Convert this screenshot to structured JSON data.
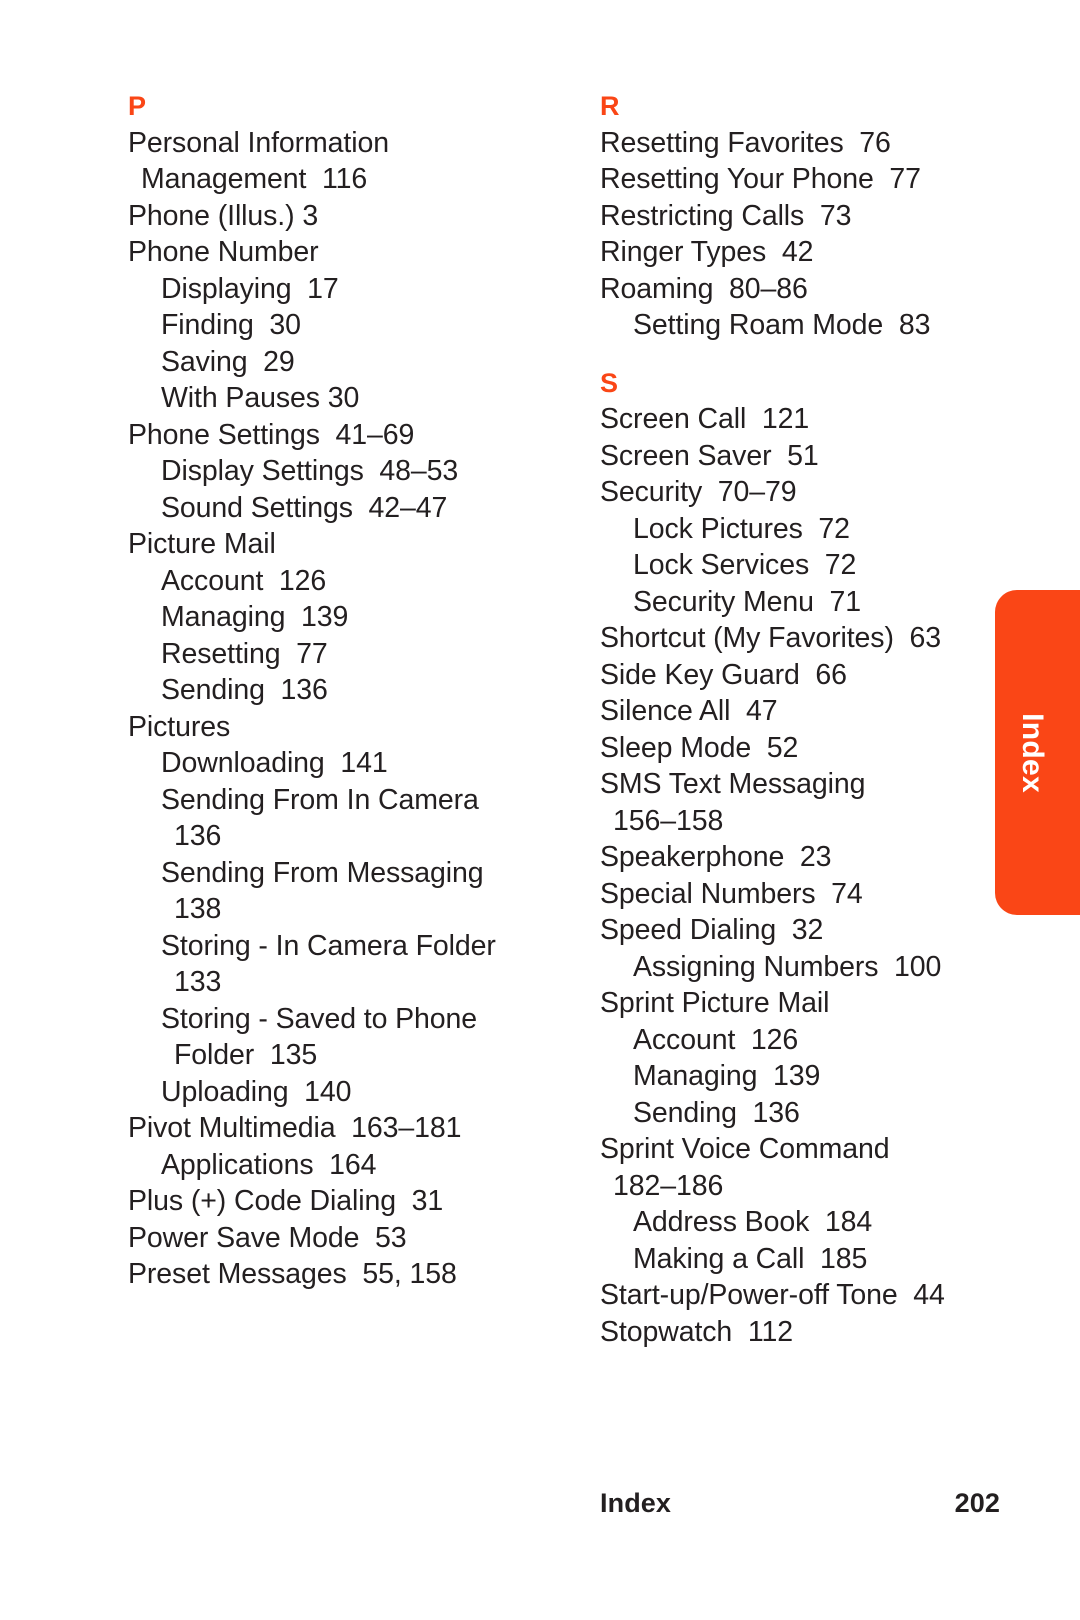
{
  "page": {
    "accent_color": "#fa4616",
    "text_color": "#231f20",
    "background_color": "#ffffff"
  },
  "side_tab": {
    "label": "Index"
  },
  "footer": {
    "label": "Index",
    "page_number": "202"
  },
  "columns": [
    {
      "name": "column-left",
      "sections": [
        {
          "letter": "P",
          "entries": [
            {
              "text": "Personal Information",
              "level": 0
            },
            {
              "text": "Management  116",
              "level": 1
            },
            {
              "text": "Phone (Illus.) 3",
              "level": 0
            },
            {
              "text": "Phone Number",
              "level": 0
            },
            {
              "text": "Displaying  17",
              "level": 2
            },
            {
              "text": "Finding  30",
              "level": 2
            },
            {
              "text": "Saving  29",
              "level": 2
            },
            {
              "text": "With Pauses 30",
              "level": 2
            },
            {
              "text": "Phone Settings  41–69",
              "level": 0
            },
            {
              "text": "Display Settings  48–53",
              "level": 2
            },
            {
              "text": "Sound Settings  42–47",
              "level": 2
            },
            {
              "text": "Picture Mail",
              "level": 0
            },
            {
              "text": "Account  126",
              "level": 2
            },
            {
              "text": "Managing  139",
              "level": 2
            },
            {
              "text": "Resetting  77",
              "level": 2
            },
            {
              "text": "Sending  136",
              "level": 2
            },
            {
              "text": "Pictures",
              "level": 0
            },
            {
              "text": "Downloading  141",
              "level": 2
            },
            {
              "text": "Sending From In Camera",
              "level": 2
            },
            {
              "text": "136",
              "level": 3
            },
            {
              "text": "Sending From Messaging",
              "level": 2
            },
            {
              "text": "138",
              "level": 3
            },
            {
              "text": "Storing - In Camera Folder",
              "level": 2
            },
            {
              "text": "133",
              "level": 3
            },
            {
              "text": "Storing - Saved to Phone",
              "level": 2
            },
            {
              "text": "Folder  135",
              "level": 3
            },
            {
              "text": "Uploading  140",
              "level": 2
            },
            {
              "text": "Pivot Multimedia  163–181",
              "level": 0
            },
            {
              "text": "Applications  164",
              "level": 2
            },
            {
              "text": "Plus (+) Code Dialing  31",
              "level": 0
            },
            {
              "text": "Power Save Mode  53",
              "level": 0
            },
            {
              "text": "Preset Messages  55, 158",
              "level": 0
            }
          ]
        }
      ]
    },
    {
      "name": "column-right",
      "sections": [
        {
          "letter": "R",
          "entries": [
            {
              "text": "Resetting Favorites  76",
              "level": 0
            },
            {
              "text": "Resetting Your Phone  77",
              "level": 0
            },
            {
              "text": "Restricting Calls  73",
              "level": 0
            },
            {
              "text": "Ringer Types  42",
              "level": 0
            },
            {
              "text": "Roaming  80–86",
              "level": 0
            },
            {
              "text": "Setting Roam Mode  83",
              "level": 2
            }
          ]
        },
        {
          "letter": "S",
          "entries": [
            {
              "text": "Screen Call  121",
              "level": 0
            },
            {
              "text": "Screen Saver  51",
              "level": 0
            },
            {
              "text": "Security  70–79",
              "level": 0
            },
            {
              "text": "Lock Pictures  72",
              "level": 2
            },
            {
              "text": "Lock Services  72",
              "level": 2
            },
            {
              "text": "Security Menu  71",
              "level": 2
            },
            {
              "text": "Shortcut (My Favorites)  63",
              "level": 0
            },
            {
              "text": "Side Key Guard  66",
              "level": 0
            },
            {
              "text": "Silence All  47",
              "level": 0
            },
            {
              "text": "Sleep Mode  52",
              "level": 0
            },
            {
              "text": "SMS Text Messaging",
              "level": 0
            },
            {
              "text": "156–158",
              "level": 1
            },
            {
              "text": "Speakerphone  23",
              "level": 0
            },
            {
              "text": "Special Numbers  74",
              "level": 0
            },
            {
              "text": "Speed Dialing  32",
              "level": 0
            },
            {
              "text": "Assigning Numbers  100",
              "level": 2
            },
            {
              "text": "Sprint Picture Mail",
              "level": 0
            },
            {
              "text": "Account  126",
              "level": 2
            },
            {
              "text": "Managing  139",
              "level": 2
            },
            {
              "text": "Sending  136",
              "level": 2
            },
            {
              "text": "Sprint Voice Command",
              "level": 0
            },
            {
              "text": "182–186",
              "level": 1
            },
            {
              "text": "Address Book  184",
              "level": 2
            },
            {
              "text": "Making a Call  185",
              "level": 2
            },
            {
              "text": "Start-up/Power-off Tone  44",
              "level": 0
            },
            {
              "text": "Stopwatch  112",
              "level": 0
            }
          ]
        }
      ]
    }
  ]
}
